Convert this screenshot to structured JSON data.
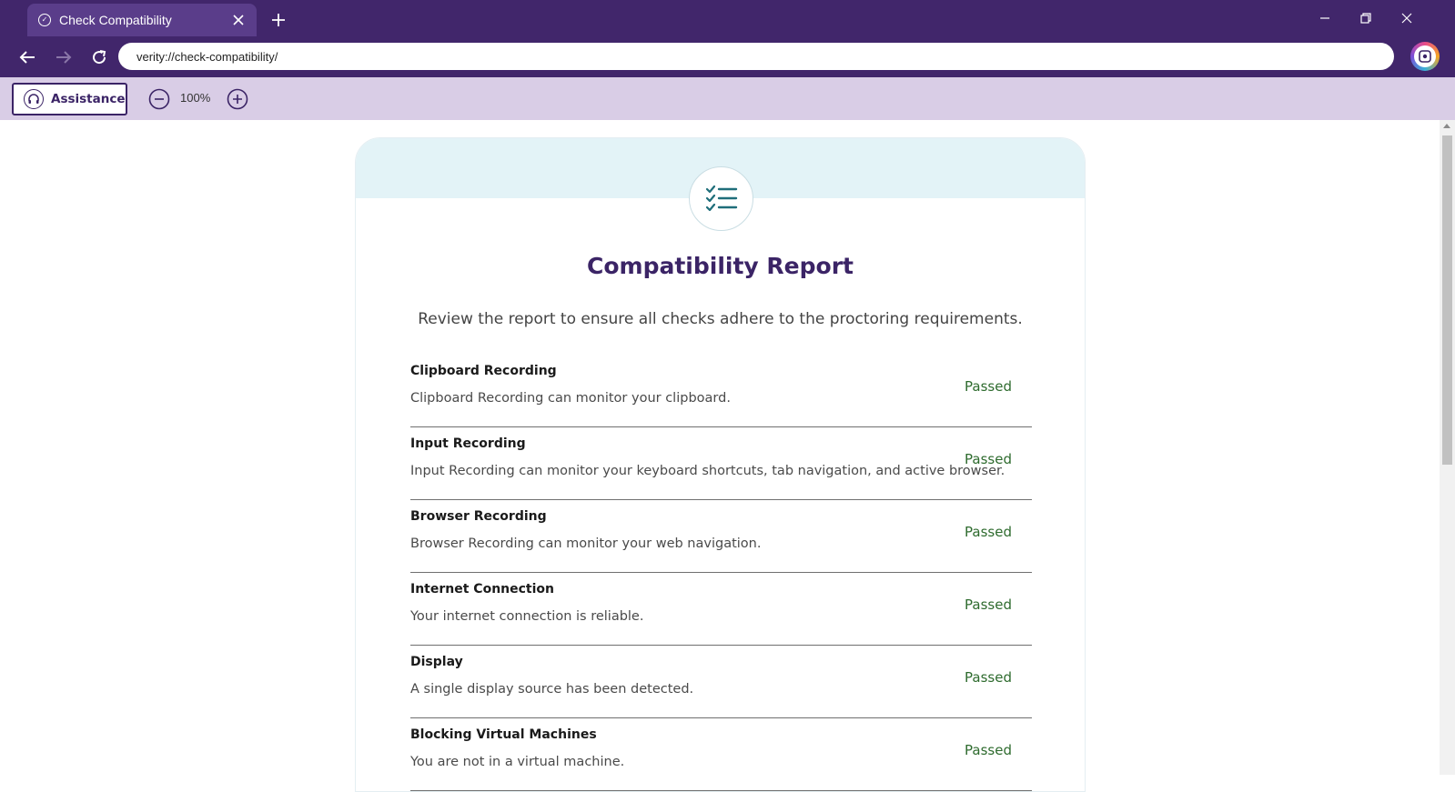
{
  "browser": {
    "tab_title": "Check Compatibility",
    "url": "verity://check-compatibility/"
  },
  "toolbar": {
    "assistance_label": "Assistance",
    "zoom_level": "100%"
  },
  "report": {
    "title": "Compatibility Report",
    "subtitle": "Review the report to ensure all checks adhere to the proctoring requirements.",
    "checks": [
      {
        "name": "Clipboard Recording",
        "description": "Clipboard Recording can monitor your clipboard.",
        "status": "Passed"
      },
      {
        "name": "Input Recording",
        "description": "Input Recording can monitor your keyboard shortcuts, tab navigation, and active browser.",
        "status": "Passed"
      },
      {
        "name": "Browser Recording",
        "description": "Browser Recording can monitor your web navigation.",
        "status": "Passed"
      },
      {
        "name": "Internet Connection",
        "description": "Your internet connection is reliable.",
        "status": "Passed"
      },
      {
        "name": "Display",
        "description": "A single display source has been detected.",
        "status": "Passed"
      },
      {
        "name": "Blocking Virtual Machines",
        "description": "You are not in a virtual machine.",
        "status": "Passed"
      }
    ]
  },
  "colors": {
    "brand": "#41266b",
    "toolbar": "#d9cde6",
    "passed": "#2e6b2e",
    "accent_teal": "#1f6e7a"
  },
  "icons": {
    "tab": "verity-favicon-icon",
    "report": "checklist-icon",
    "assistance": "headset-icon"
  }
}
